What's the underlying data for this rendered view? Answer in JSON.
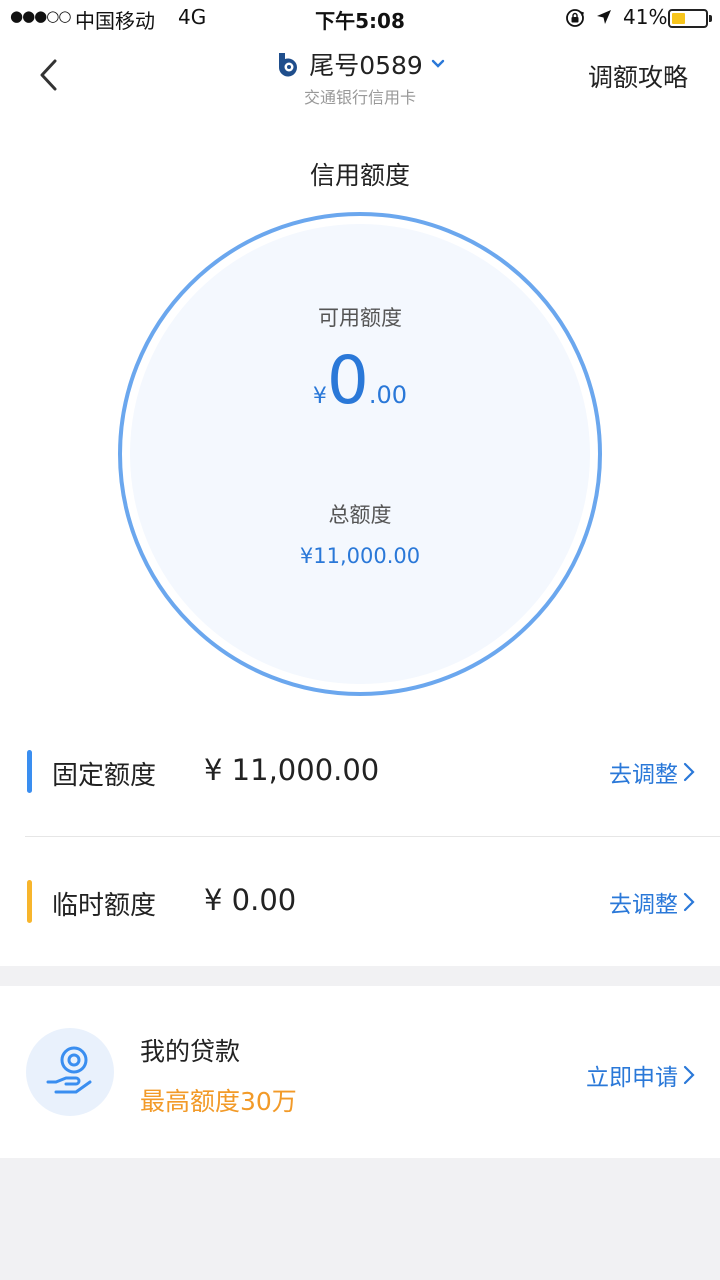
{
  "status_bar": {
    "signal": "●●●○○",
    "carrier": "中国移动",
    "network": "4G",
    "time": "下午5:08",
    "battery_percent": "41%",
    "battery_level": 0.41,
    "battery_color": "#f7c51c"
  },
  "nav": {
    "title": "尾号0589",
    "subtitle": "交通银行信用卡",
    "right_action": "调额攻略"
  },
  "credit": {
    "section_title": "信用额度",
    "available_label": "可用额度",
    "available_symbol": "¥",
    "available_integer": "0",
    "available_decimal": ".00",
    "total_label": "总额度",
    "total_amount": "¥11,000.00"
  },
  "limits": [
    {
      "name": "固定额度",
      "amount": "¥ 11,000.00",
      "action": "去调整",
      "color": "#3a8ef0"
    },
    {
      "name": "临时额度",
      "amount": "¥ 0.00",
      "action": "去调整",
      "color": "#f7b52c"
    }
  ],
  "loan": {
    "title": "我的贷款",
    "subtitle": "最高额度30万",
    "action": "立即申请"
  },
  "colors": {
    "accent_blue": "#2a78d8",
    "ring_blue": "#6ba7ee",
    "orange": "#f29a28"
  }
}
